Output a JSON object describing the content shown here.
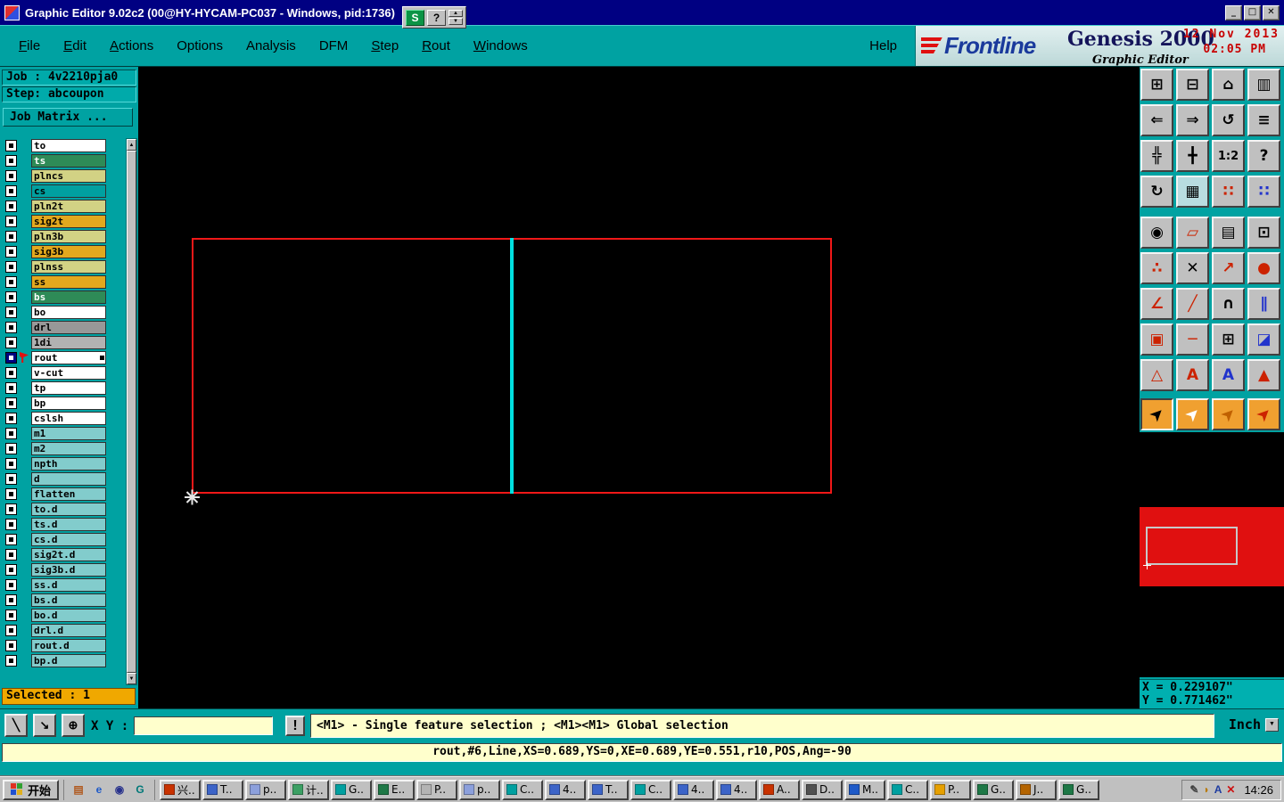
{
  "titlebar": {
    "title": "Graphic Editor 9.02c2 (00@HY-HYCAM-PC037 - Windows, pid:1736)",
    "controls": {
      "minimize": "_",
      "maximize": "□",
      "close": "✕"
    }
  },
  "mini_toolbar": {
    "s_label": "S",
    "help_label": "?",
    "spin_up": "▲",
    "spin_down": "▼"
  },
  "menubar": {
    "items": [
      {
        "label": "File",
        "u": 0
      },
      {
        "label": "Edit",
        "u": 0
      },
      {
        "label": "Actions",
        "u": 0
      },
      {
        "label": "Options",
        "u": -1
      },
      {
        "label": "Analysis",
        "u": -1
      },
      {
        "label": "DFM",
        "u": -1
      },
      {
        "label": "Step",
        "u": 0
      },
      {
        "label": "Rout",
        "u": 0
      },
      {
        "label": "Windows",
        "u": 0
      }
    ],
    "help": "Help"
  },
  "branding": {
    "logo_text": "Frontline",
    "product": "Genesis 2000",
    "edition": "Graphic Editor",
    "date": "12 Nov 2013",
    "time": "02:05 PM"
  },
  "sidebar": {
    "job": "Job : 4v2210pja0",
    "step": "Step: abcoupon",
    "job_matrix": "Job Matrix ...",
    "selected": "Selected : 1",
    "scrollbar": {
      "up": "▲",
      "down": "▼"
    },
    "layers": [
      {
        "name": "to",
        "bg": "#ffffff"
      },
      {
        "name": "ts",
        "bg": "#2e8b57",
        "fg": "#ffffff"
      },
      {
        "name": "plncs",
        "bg": "#d2d284"
      },
      {
        "name": "cs",
        "bg": "#00a0a0"
      },
      {
        "name": "pln2t",
        "bg": "#d2d284"
      },
      {
        "name": "sig2t",
        "bg": "#e2a81e"
      },
      {
        "name": "pln3b",
        "bg": "#d2d284"
      },
      {
        "name": "sig3b",
        "bg": "#e2a81e"
      },
      {
        "name": "plnss",
        "bg": "#d2d284"
      },
      {
        "name": "ss",
        "bg": "#e2a81e"
      },
      {
        "name": "bs",
        "bg": "#2e8b57",
        "fg": "#ffffff"
      },
      {
        "name": "bo",
        "bg": "#ffffff"
      },
      {
        "name": "drl",
        "bg": "#989898"
      },
      {
        "name": "1di",
        "bg": "#b2b2b2"
      },
      {
        "name": "rout",
        "bg": "#ffffff",
        "current": true
      },
      {
        "name": "v-cut",
        "bg": "#ffffff"
      },
      {
        "name": "tp",
        "bg": "#ffffff"
      },
      {
        "name": "bp",
        "bg": "#ffffff"
      },
      {
        "name": "cslsh",
        "bg": "#ffffff"
      },
      {
        "name": "m1",
        "bg": "#82cccc"
      },
      {
        "name": "m2",
        "bg": "#82cccc"
      },
      {
        "name": "npth",
        "bg": "#82cccc"
      },
      {
        "name": "d",
        "bg": "#82cccc"
      },
      {
        "name": "flatten",
        "bg": "#82cccc"
      },
      {
        "name": "to.d",
        "bg": "#82cccc"
      },
      {
        "name": "ts.d",
        "bg": "#82cccc"
      },
      {
        "name": "cs.d",
        "bg": "#82cccc"
      },
      {
        "name": "sig2t.d",
        "bg": "#82cccc"
      },
      {
        "name": "sig3b.d",
        "bg": "#82cccc"
      },
      {
        "name": "ss.d",
        "bg": "#82cccc"
      },
      {
        "name": "bs.d",
        "bg": "#82cccc"
      },
      {
        "name": "bo.d",
        "bg": "#82cccc"
      },
      {
        "name": "drl.d",
        "bg": "#82cccc"
      },
      {
        "name": "rout.d",
        "bg": "#82cccc"
      },
      {
        "name": "bp.d",
        "bg": "#82cccc"
      }
    ]
  },
  "toolbar": {
    "rows": [
      [
        {
          "name": "copy-view-icon",
          "glyph": "⊞"
        },
        {
          "name": "paste-view-icon",
          "glyph": "⊟"
        },
        {
          "name": "home-view-icon",
          "glyph": "⌂"
        },
        {
          "name": "split-view-icon",
          "glyph": "▥"
        }
      ],
      [
        {
          "name": "view-back-icon",
          "glyph": "⇐"
        },
        {
          "name": "view-forward-icon",
          "glyph": "⇒"
        },
        {
          "name": "zoom-previous-icon",
          "glyph": "↺"
        },
        {
          "name": "layers-panel-icon",
          "glyph": "≡"
        }
      ],
      [
        {
          "name": "zoom-fit-icon",
          "glyph": "╬"
        },
        {
          "name": "pan-view-icon",
          "glyph": "╋"
        },
        {
          "name": "zoom-ratio-icon",
          "glyph": "1:2",
          "small": true
        },
        {
          "name": "help-tool-icon",
          "glyph": "?"
        }
      ],
      [
        {
          "name": "redraw-icon",
          "glyph": "↻"
        },
        {
          "name": "grid-toggle-icon",
          "glyph": "▦",
          "bg": "#b8dce0"
        },
        {
          "name": "snap-points-icon",
          "glyph": "∷",
          "fg": "#cc2200"
        },
        {
          "name": "snap-grid-icon",
          "glyph": "∷",
          "fg": "#2233cc"
        }
      ],
      [
        {
          "name": "center-point-icon",
          "glyph": "◉"
        },
        {
          "name": "profile-select-icon",
          "glyph": "▱",
          "fg": "#cc2200"
        },
        {
          "name": "ruler-icon",
          "glyph": "▤"
        },
        {
          "name": "select-dot-icon",
          "glyph": "⊡"
        }
      ],
      [
        {
          "name": "pair-points-icon",
          "glyph": "∴",
          "fg": "#cc2200"
        },
        {
          "name": "delete-point-icon",
          "glyph": "✕"
        },
        {
          "name": "move-point-icon",
          "glyph": "↗",
          "fg": "#cc2200"
        },
        {
          "name": "add-point-icon",
          "glyph": "●",
          "fg": "#cc2200"
        }
      ],
      [
        {
          "name": "angle-measure-icon",
          "glyph": "∠",
          "fg": "#cc2200"
        },
        {
          "name": "line-slope-icon",
          "glyph": "╱",
          "fg": "#cc2200"
        },
        {
          "name": "arc-tool-icon",
          "glyph": "∩"
        },
        {
          "name": "barrier-tool-icon",
          "glyph": "∥",
          "fg": "#2233cc"
        }
      ],
      [
        {
          "name": "pad-tool-icon",
          "glyph": "▣",
          "fg": "#cc2200"
        },
        {
          "name": "erase-line-icon",
          "glyph": "─",
          "fg": "#cc2200"
        },
        {
          "name": "dimension-box-icon",
          "glyph": "⊞"
        },
        {
          "name": "shape-fill-icon",
          "glyph": "◪",
          "fg": "#2233cc"
        }
      ],
      [
        {
          "name": "triangle-outline-icon",
          "glyph": "△",
          "fg": "#cc2200"
        },
        {
          "name": "text-a-red-icon",
          "glyph": "A",
          "fg": "#cc2200"
        },
        {
          "name": "text-a-blue-icon",
          "glyph": "A",
          "fg": "#2233cc"
        },
        {
          "name": "triangle-solid-icon",
          "glyph": "▲",
          "fg": "#cc2200"
        }
      ],
      [
        {
          "name": "select-mode-icon",
          "glyph": "➤",
          "bg": "#f0a030",
          "rot": true,
          "pressed": true
        },
        {
          "name": "select-frame-icon",
          "glyph": "➤",
          "fg": "#ffffff",
          "bg": "#f0a030",
          "rot": true
        },
        {
          "name": "select-ref-icon",
          "glyph": "➤",
          "fg": "#c06000",
          "bg": "#f0a030",
          "rot": true
        },
        {
          "name": "select-special-icon",
          "glyph": "➤",
          "fg": "#cc2200",
          "bg": "#f0a030",
          "rot": true
        }
      ]
    ]
  },
  "coords": {
    "x": "X = 0.229107\"",
    "y": "Y = 0.771462\""
  },
  "statusbar": {
    "tools": [
      {
        "name": "line-mode-icon",
        "glyph": "╲"
      },
      {
        "name": "snap-arrow-icon",
        "glyph": "↘"
      },
      {
        "name": "grid-origin-icon",
        "glyph": "⊕"
      }
    ],
    "xy_label": "X Y :",
    "input_value": "",
    "alert": "!",
    "message": "<M1> - Single feature selection ; <M1><M1> Global selection",
    "units": "Inch",
    "units_spin": "▼"
  },
  "feature_info": "rout,#6,Line,XS=0.689,YS=0,XE=0.689,YE=0.551,r10,POS,Ang=-90",
  "taskbar": {
    "start": "开始",
    "quick_launch": [
      {
        "name": "show-desktop-icon",
        "glyph": "▤",
        "color": "#b05a20"
      },
      {
        "name": "browser-icon",
        "glyph": "e",
        "color": "#1e5ac8"
      },
      {
        "name": "media-icon",
        "glyph": "◉",
        "color": "#28328c"
      },
      {
        "name": "genesis-app-icon",
        "glyph": "G",
        "color": "#007878"
      }
    ],
    "buttons": [
      {
        "label": "兴..",
        "color": "#c83200"
      },
      {
        "label": "T..",
        "color": "#3c64c8"
      },
      {
        "label": "p..",
        "color": "#8ca0dc"
      },
      {
        "label": "计..",
        "color": "#3ca064"
      },
      {
        "label": "G..",
        "color": "#00a0a0"
      },
      {
        "label": "E..",
        "color": "#1e7846"
      },
      {
        "label": "P..",
        "color": "#b4b4b4"
      },
      {
        "label": "p..",
        "color": "#8ca0dc"
      },
      {
        "label": "C..",
        "color": "#00a0a0"
      },
      {
        "label": "4..",
        "color": "#3c64c8"
      },
      {
        "label": "T..",
        "color": "#3c64c8"
      },
      {
        "label": "C..",
        "color": "#00a0a0"
      },
      {
        "label": "4..",
        "color": "#3c64c8"
      },
      {
        "label": "4..",
        "color": "#3c64c8"
      },
      {
        "label": "A..",
        "color": "#c83200"
      },
      {
        "label": "D..",
        "color": "#505050"
      },
      {
        "label": "M..",
        "color": "#1e5ac8"
      },
      {
        "label": "C..",
        "color": "#00a0a0"
      },
      {
        "label": "P..",
        "color": "#e6a000"
      },
      {
        "label": "G..",
        "color": "#1e7846"
      },
      {
        "label": "J..",
        "color": "#b46400"
      },
      {
        "label": "G..",
        "color": "#1e7846"
      }
    ],
    "tray": {
      "icons": [
        {
          "name": "pen-tray-icon",
          "glyph": "✎",
          "color": "#404040"
        },
        {
          "name": "brush-tray-icon",
          "glyph": "◗",
          "color": "#b87800"
        },
        {
          "name": "ime-tray-icon",
          "glyph": "A",
          "color": "#1e3ca0"
        },
        {
          "name": "alert-tray-icon",
          "glyph": "✕",
          "color": "#cc1010"
        }
      ],
      "time": "14:26"
    }
  }
}
